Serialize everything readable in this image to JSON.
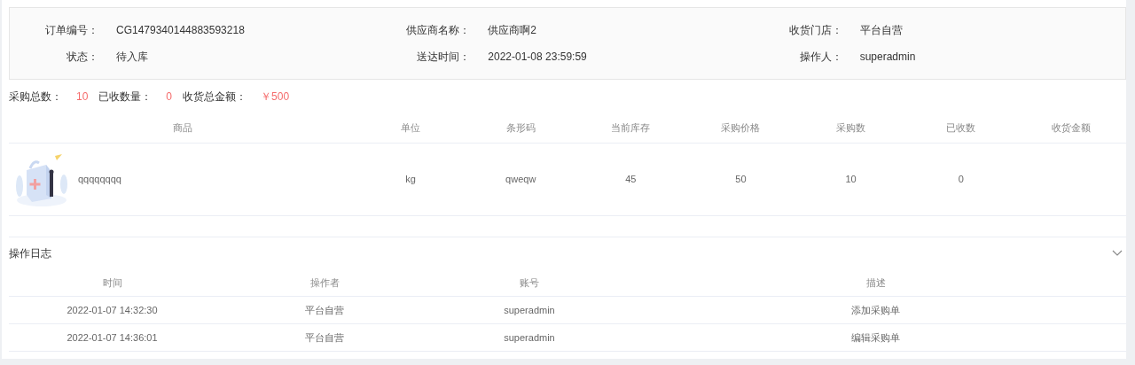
{
  "order_info": [
    {
      "label": "订单编号：",
      "value": "CG1479340144883593218"
    },
    {
      "label": "供应商名称：",
      "value": "供应商啊2"
    },
    {
      "label": "收货门店：",
      "value": "平台自营"
    },
    {
      "label": "状态：",
      "value": "待入库"
    },
    {
      "label": "送达时间：",
      "value": "2022-01-08 23:59:59"
    },
    {
      "label": "操作人：",
      "value": "superadmin"
    }
  ],
  "summary": [
    {
      "label": "采购总数：",
      "value": "10"
    },
    {
      "label": "已收数量：",
      "value": "0"
    },
    {
      "label": "收货总金额：",
      "value": "￥500"
    }
  ],
  "goods_table": {
    "columns": [
      "商品",
      "单位",
      "条形码",
      "当前库存",
      "采购价格",
      "采购数",
      "已收数",
      "收货金额"
    ],
    "rows": [
      {
        "cells": [
          "qqqqqqqq",
          "kg",
          "qweqw",
          "45",
          "50",
          "10",
          "0",
          ""
        ]
      }
    ]
  },
  "log": {
    "title": "操作日志",
    "expanded": true,
    "columns": [
      "时间",
      "操作者",
      "账号",
      "描述"
    ],
    "rows": [
      [
        "2022-01-07 14:32:30",
        "平台自营",
        "superadmin",
        "添加采购单"
      ],
      [
        "2022-01-07 14:36:01",
        "平台自营",
        "superadmin",
        "编辑采购单"
      ]
    ]
  }
}
